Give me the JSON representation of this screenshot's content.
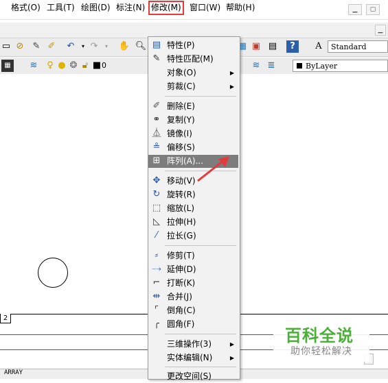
{
  "titlebar": {
    "minimize_icon": "minimize-icon",
    "restore_icon": "restore-icon"
  },
  "menubar": [
    {
      "label": "格式(O)"
    },
    {
      "label": "工具(T)"
    },
    {
      "label": "绘图(D)"
    },
    {
      "label": "标注(N)"
    },
    {
      "label": "修改(M)",
      "active": true,
      "highlight_color": "#e33b3b"
    },
    {
      "label": "窗口(W)"
    },
    {
      "label": "帮助(H)"
    }
  ],
  "toolbar1": {
    "text_style_value": "Standard"
  },
  "toolbar2": {
    "layer_value": "0",
    "linetype_value": "ByLayer"
  },
  "tab_label": "2",
  "status_text": "ARRAY",
  "dropdown": {
    "items": [
      {
        "label": "特性(P)",
        "icon": "properties-icon"
      },
      {
        "label": "特性匹配(M)",
        "icon": "match-properties-icon"
      },
      {
        "label": "对象(O)",
        "icon": "",
        "submenu": true
      },
      {
        "label": "剪裁(C)",
        "icon": "",
        "submenu": true
      },
      {
        "label": "删除(E)",
        "icon": "erase-icon"
      },
      {
        "label": "复制(Y)",
        "icon": "copy-icon"
      },
      {
        "label": "镜像(I)",
        "icon": "mirror-icon"
      },
      {
        "label": "偏移(S)",
        "icon": "offset-icon"
      },
      {
        "label": "阵列(A)...",
        "icon": "array-icon",
        "highlighted": true
      },
      {
        "label": "移动(V)",
        "icon": "move-icon"
      },
      {
        "label": "旋转(R)",
        "icon": "rotate-icon"
      },
      {
        "label": "缩放(L)",
        "icon": "scale-icon"
      },
      {
        "label": "拉伸(H)",
        "icon": "stretch-icon"
      },
      {
        "label": "拉长(G)",
        "icon": "lengthen-icon"
      },
      {
        "label": "修剪(T)",
        "icon": "trim-icon"
      },
      {
        "label": "延伸(D)",
        "icon": "extend-icon"
      },
      {
        "label": "打断(K)",
        "icon": "break-icon"
      },
      {
        "label": "合并(J)",
        "icon": "join-icon"
      },
      {
        "label": "倒角(C)",
        "icon": "chamfer-icon"
      },
      {
        "label": "圆角(F)",
        "icon": "fillet-icon"
      },
      {
        "label": "三维操作(3)",
        "icon": "",
        "submenu": true
      },
      {
        "label": "实体编辑(N)",
        "icon": "",
        "submenu": true
      },
      {
        "label": "更改空间(S)",
        "icon": ""
      }
    ]
  },
  "annotation": {
    "arrow_color": "#e33b3b"
  },
  "watermark": {
    "title": "百科全说",
    "subtitle": "助你轻松解决",
    "color": "#4caf3a"
  }
}
